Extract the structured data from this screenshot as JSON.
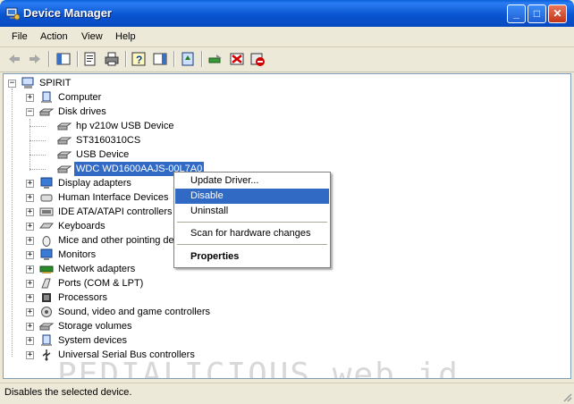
{
  "window": {
    "title": "Device Manager"
  },
  "menu": [
    "File",
    "Action",
    "View",
    "Help"
  ],
  "toolbar": [
    "back-icon",
    "forward-icon",
    "show-hide-tree-icon",
    "properties-icon",
    "print-icon",
    "help-icon",
    "action-pane-icon",
    "update-driver-icon",
    "scan-hardware-icon",
    "uninstall-icon",
    "disable-icon"
  ],
  "tree": {
    "root": "SPIRIT",
    "categories": [
      {
        "label": "Computer",
        "expanded": false
      },
      {
        "label": "Disk drives",
        "expanded": true,
        "children": [
          "hp v210w USB Device",
          "ST3160310CS",
          "USB Device",
          "WDC WD1600AAJS-00L7A0"
        ]
      },
      {
        "label": "Display adapters",
        "expanded": false
      },
      {
        "label": "Human Interface Devices",
        "expanded": false
      },
      {
        "label": "IDE ATA/ATAPI controllers",
        "expanded": false
      },
      {
        "label": "Keyboards",
        "expanded": false
      },
      {
        "label": "Mice and other pointing devices",
        "expanded": false
      },
      {
        "label": "Monitors",
        "expanded": false
      },
      {
        "label": "Network adapters",
        "expanded": false
      },
      {
        "label": "Ports (COM & LPT)",
        "expanded": false
      },
      {
        "label": "Processors",
        "expanded": false
      },
      {
        "label": "Sound, video and game controllers",
        "expanded": false
      },
      {
        "label": "Storage volumes",
        "expanded": false
      },
      {
        "label": "System devices",
        "expanded": false
      },
      {
        "label": "Universal Serial Bus controllers",
        "expanded": false
      }
    ],
    "selected": "WDC WD1600AAJS-00L7A0"
  },
  "context_menu": {
    "items": [
      {
        "label": "Update Driver...",
        "highlighted": false,
        "bold": false
      },
      {
        "label": "Disable",
        "highlighted": true,
        "bold": false
      },
      {
        "label": "Uninstall",
        "highlighted": false,
        "bold": false
      },
      {
        "label": "Scan for hardware changes",
        "highlighted": false,
        "bold": false
      },
      {
        "label": "Properties",
        "highlighted": false,
        "bold": true
      }
    ]
  },
  "watermark": "PEDIALICIOUS.web.id",
  "status": "Disables the selected device.",
  "colors": {
    "title_bar": "#0a55d1",
    "selection": "#316ac5"
  }
}
